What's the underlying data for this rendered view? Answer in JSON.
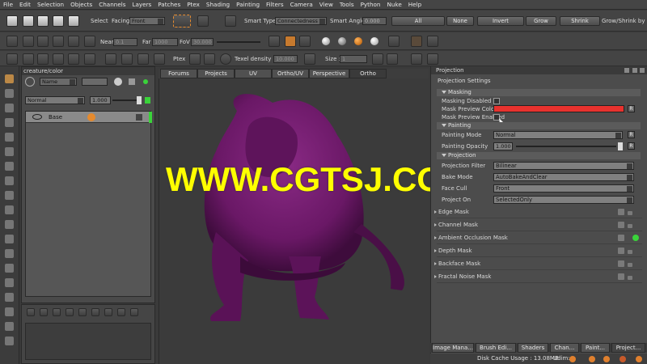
{
  "menu": [
    "File",
    "Edit",
    "Selection",
    "Objects",
    "Channels",
    "Layers",
    "Patches",
    "Ptex",
    "Shading",
    "Painting",
    "Filters",
    "Camera",
    "View",
    "Tools",
    "Python",
    "Nuke",
    "Help"
  ],
  "toolbar1": {
    "select_label": "Select",
    "facing_label": "Facing",
    "facing_value": "Front",
    "smart_type_label": "Smart Type:",
    "smart_type_value": "Connectedness",
    "smart_angle_label": "Smart Angle",
    "smart_angle_value": "0.000",
    "all": "All",
    "none": "None",
    "invert": "Invert",
    "grow": "Grow",
    "shrink": "Shrink",
    "grow_shrink_by": "Grow/Shrink by"
  },
  "toolbar2": {
    "near_label": "Near",
    "near_value": "0.1",
    "far_label": "Far",
    "far_value": "1000",
    "fov_label": "FoV",
    "fov_value": "30.000"
  },
  "toolbar3": {
    "ptex_label": "Ptex",
    "texel_label": "Texel density :",
    "texel_value": "10.000",
    "size_label": "Size :",
    "size_value": "1"
  },
  "layers": {
    "title": "creature/color",
    "filter_combo": "Name",
    "blend_mode": "Normal",
    "opacity": "1.000",
    "items": [
      {
        "name": "Base"
      }
    ]
  },
  "viewport": {
    "tabs": [
      "Forums",
      "Projects",
      "UV",
      "Ortho/UV",
      "Perspective",
      "Ortho"
    ],
    "active_tab": "Ortho",
    "watermark": "WWW.CGTSJ.COM"
  },
  "projection": {
    "title": "Projection",
    "settings_title": "Projection Settings",
    "masking": {
      "header": "Masking",
      "masking_disabled": "Masking Disabled",
      "mask_preview_color": "Mask Preview Color",
      "mask_preview_enabled": "Mask Preview Enabled",
      "color": "#e8322e"
    },
    "painting": {
      "header": "Painting",
      "mode_label": "Painting Mode",
      "mode_value": "Normal",
      "opacity_label": "Painting Opacity",
      "opacity_value": "1.000"
    },
    "proj_section": {
      "header": "Projection",
      "filter_label": "Projection Filter",
      "filter_value": "Bilinear",
      "bake_label": "Bake Mode",
      "bake_value": "AutoBakeAndClear",
      "face_label": "Face Cull",
      "face_value": "Front",
      "on_label": "Project On",
      "on_value": "SelectedOnly"
    },
    "masks": [
      "Edge Mask",
      "Channel Mask",
      "Ambient Occlusion Mask",
      "Depth Mask",
      "Backface Mask",
      "Fractal Noise Mask"
    ]
  },
  "bottom_tabs": [
    "Image Mana...",
    "Brush Edi...",
    "Shaders",
    "Chan...",
    "Paint...",
    "Project..."
  ],
  "status": {
    "disk_cache": "Disk Cache Usage : 13.08MB",
    "udim": "Udim:"
  },
  "colors": {
    "creature": "#6e1a6a",
    "accent_green": "#3ad33a",
    "watermark": "#ffff00"
  }
}
